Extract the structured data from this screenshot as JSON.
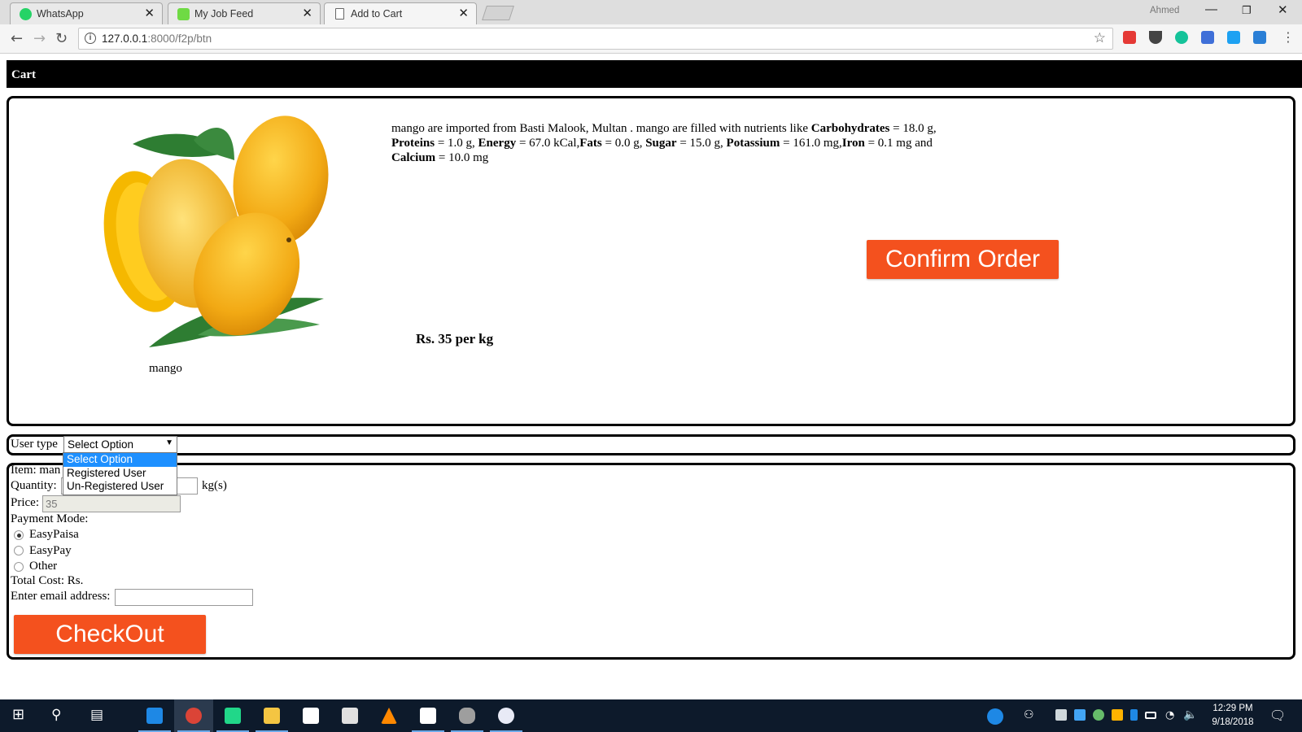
{
  "browser": {
    "tabs": [
      {
        "label": "WhatsApp",
        "icon": "whatsapp-icon",
        "color": "#25d366"
      },
      {
        "label": "My Job Feed",
        "icon": "upwork-icon",
        "color": "#6fda44"
      },
      {
        "label": "Add to Cart",
        "icon": "page-icon",
        "color": "#ffffff"
      }
    ],
    "profile_name": "Ahmed",
    "url_host": "127.0.0.1",
    "url_path": ":8000/f2p/btn"
  },
  "page": {
    "header": "Cart",
    "product": {
      "name": "mango",
      "description_parts": [
        {
          "t": "mango are imported from Basti Malook, Multan . mango are filled with nutrients like ",
          "b": false
        },
        {
          "t": "Carbohydrates",
          "b": true
        },
        {
          "t": " = 18.0 g, ",
          "b": false
        },
        {
          "t": "Proteins",
          "b": true
        },
        {
          "t": " = 1.0 g, ",
          "b": false
        },
        {
          "t": "Energy",
          "b": true
        },
        {
          "t": " = 67.0 kCal,",
          "b": false
        },
        {
          "t": "Fats",
          "b": true
        },
        {
          "t": " = 0.0 g, ",
          "b": false
        },
        {
          "t": "Sugar",
          "b": true
        },
        {
          "t": " = 15.0 g, ",
          "b": false
        },
        {
          "t": "Potassium",
          "b": true
        },
        {
          "t": " = 161.0 mg,",
          "b": false
        },
        {
          "t": "Iron",
          "b": true
        },
        {
          "t": " = 0.1 mg and ",
          "b": false
        },
        {
          "t": "Calcium",
          "b": true
        },
        {
          "t": " = 10.0 mg",
          "b": false
        }
      ],
      "price_text": "Rs. 35 per kg",
      "confirm_label": "Confirm Order"
    },
    "user_type": {
      "label": "User type",
      "selected": "Select Option",
      "options": [
        "Select Option",
        "Registered User",
        "Un-Registered User"
      ]
    },
    "form": {
      "item_label": "Item:",
      "item_value": "man",
      "quantity_label": "Quantity:",
      "quantity_unit": "kg(s)",
      "price_label": "Price:",
      "price_value": "35",
      "payment_label": "Payment Mode:",
      "payment_options": [
        {
          "label": "EasyPaisa",
          "checked": true
        },
        {
          "label": "EasyPay",
          "checked": false
        },
        {
          "label": "Other",
          "checked": false
        }
      ],
      "total_label": "Total Cost: Rs.",
      "email_label": "Enter email address:",
      "checkout_label": "CheckOut"
    }
  },
  "taskbar": {
    "time": "12:29 PM",
    "date": "9/18/2018"
  },
  "colors": {
    "accent": "#f4511e",
    "header_bg": "#000000",
    "taskbar_bg": "#0d1a2b",
    "dropdown_highlight": "#1e90ff"
  }
}
